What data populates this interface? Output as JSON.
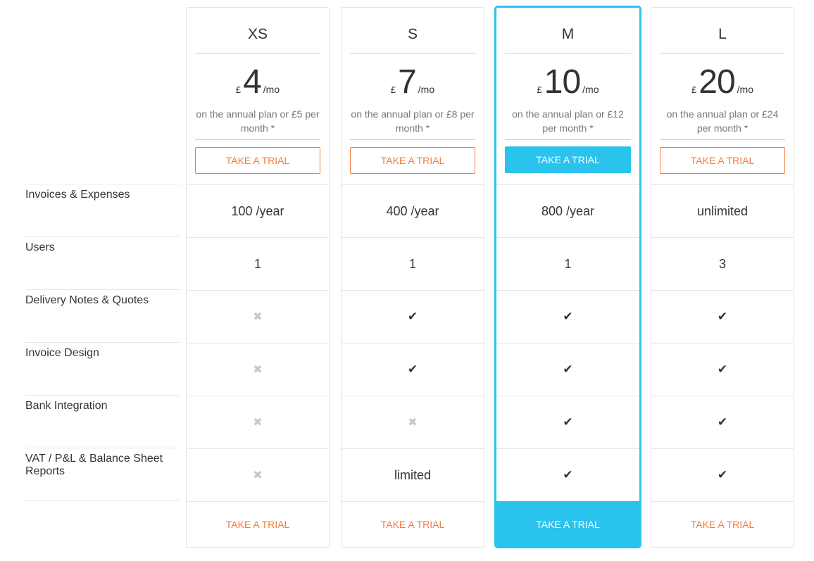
{
  "features": [
    "Invoices & Expenses",
    "Users",
    "Delivery Notes & Quotes",
    "Invoice Design",
    "Bank Integration",
    "VAT / P&L & Balance Sheet Reports"
  ],
  "plans": [
    {
      "name": "XS",
      "currency": "£",
      "price": "4",
      "per": "/mo",
      "note": "on the annual plan or £5 per month *",
      "cta": "TAKE A TRIAL",
      "featured": false,
      "values": [
        "100 /year",
        "1",
        "cross",
        "cross",
        "cross",
        "cross"
      ]
    },
    {
      "name": "S",
      "currency": "£",
      "price": "7",
      "per": "/mo",
      "note": "on the annual plan or £8 per month *",
      "cta": "TAKE A TRIAL",
      "featured": false,
      "values": [
        "400 /year",
        "1",
        "check",
        "check",
        "cross",
        "limited"
      ]
    },
    {
      "name": "M",
      "currency": "£",
      "price": "10",
      "per": "/mo",
      "note": "on the annual plan or £12 per month *",
      "cta": "TAKE A TRIAL",
      "featured": true,
      "values": [
        "800 /year",
        "1",
        "check",
        "check",
        "check",
        "check"
      ]
    },
    {
      "name": "L",
      "currency": "£",
      "price": "20",
      "per": "/mo",
      "note": "on the annual plan or £24 per month *",
      "cta": "TAKE A TRIAL",
      "featured": false,
      "values": [
        "unlimited",
        "3",
        "check",
        "check",
        "check",
        "check"
      ]
    }
  ],
  "icons": {
    "check": "✔",
    "cross": "✖"
  },
  "colors": {
    "accent": "#2ac3ed",
    "cta": "#f47c3c"
  }
}
